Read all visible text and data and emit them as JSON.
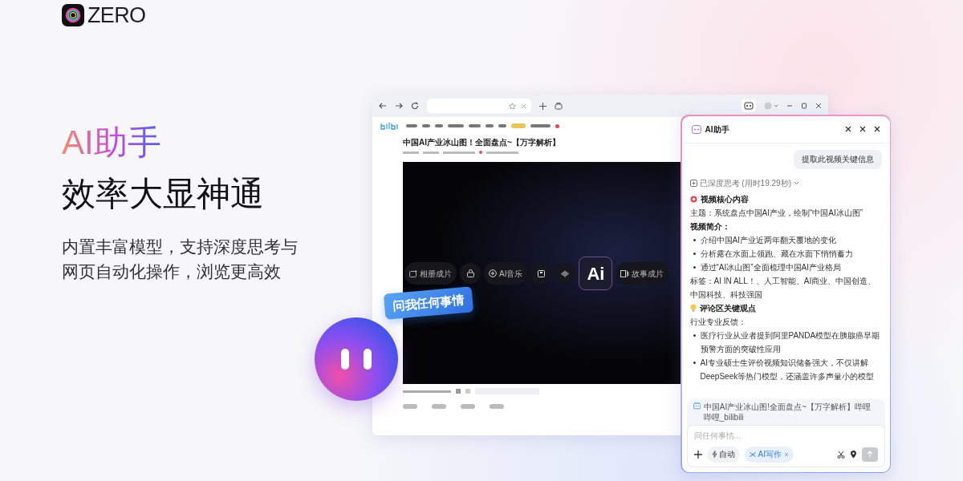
{
  "brand": {
    "name": "ZERO"
  },
  "hero": {
    "accent": "AI助手",
    "title": "效率大显神通",
    "subtitle_lines": [
      "内置丰富模型，支持深度思考与",
      "网页自动化操作，浏览更高效"
    ]
  },
  "browser": {
    "page_title": "中国AI产业冰山图！全面盘点~【万字解析】",
    "video_tools": [
      {
        "kind": "pill",
        "label": "相册成片"
      },
      {
        "kind": "round"
      },
      {
        "kind": "pill",
        "label": "AI音乐"
      },
      {
        "kind": "round"
      },
      {
        "kind": "round"
      },
      {
        "kind": "ai",
        "label": "Ai"
      },
      {
        "kind": "pill",
        "label": "故事成片"
      }
    ]
  },
  "ask_badge": "问我任何事情",
  "assistant": {
    "title": "AI助手",
    "user_message": "提取此视频关键信息",
    "thinking": "已深度思考 (用时19.29秒)",
    "blocks": [
      {
        "kind": "heading",
        "text": "视频核心内容"
      },
      {
        "kind": "para",
        "text": "主题：系统盘点中国AI产业，绘制“中国AI冰山图”"
      },
      {
        "kind": "label",
        "text": "视频简介："
      },
      {
        "kind": "bullet",
        "text": "介绍中国AI产业近两年翻天覆地的变化"
      },
      {
        "kind": "bullet",
        "text": "分析露在水面上领跑、藏在水面下悄悄蓄力"
      },
      {
        "kind": "bullet",
        "text": "通过“AI冰山图”全面梳理中国AI产业格局"
      },
      {
        "kind": "para",
        "text": "标签：AI IN ALL！、人工智能、AI商业、中国创造、中国科技、科技强国"
      },
      {
        "kind": "heading",
        "text": "评论区关键观点"
      },
      {
        "kind": "para",
        "text": "行业专业反馈："
      },
      {
        "kind": "bullet",
        "text": "医疗行业从业者提到阿里PANDA模型在胰腺癌早期预警方面的突破性应用"
      },
      {
        "kind": "bullet",
        "text": "AI专业硕士生评价视频知识储备强大，不仅讲解DeepSeek等热门模型，还涵盖许多声量小的模型"
      }
    ],
    "context_tab": "中国AI产业冰山图!全面盘点~【万字解析】哔哩哔哩_bilibili",
    "input": {
      "placeholder": "问任何事情..."
    },
    "chips": [
      {
        "kind": "mode",
        "label": "自动"
      },
      {
        "kind": "tag",
        "label": "AI写作"
      }
    ]
  }
}
